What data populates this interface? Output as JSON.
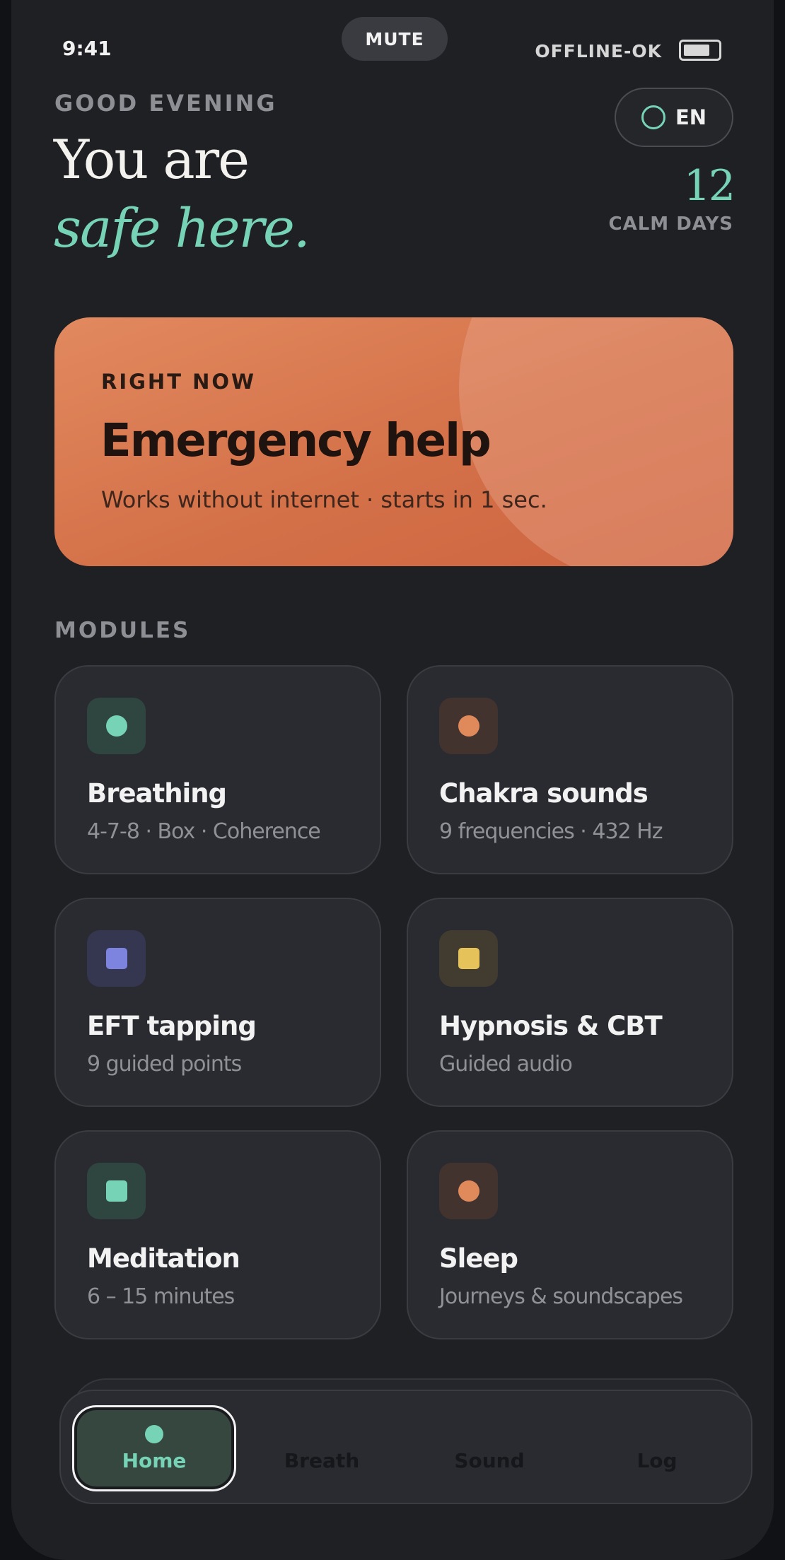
{
  "status": {
    "time": "9:41",
    "mute": "MUTE",
    "offline": "OFFLINE-OK"
  },
  "header": {
    "greeting": "GOOD EVENING",
    "title_line1": "You are",
    "title_line2": "safe here.",
    "language": "EN",
    "calm_days_value": "12",
    "calm_days_label": "CALM DAYS"
  },
  "emergency": {
    "kicker": "RIGHT NOW",
    "title": "Emergency help",
    "subtitle": "Works without internet · starts in 1 sec."
  },
  "modules": {
    "label": "MODULES",
    "items": [
      {
        "title": "Breathing",
        "subtitle": "4-7-8 · Box · Coherence",
        "icon": "breathing-dot-icon",
        "color": "#76d3b6"
      },
      {
        "title": "Chakra sounds",
        "subtitle": "9 frequencies · 432 Hz",
        "icon": "chakra-dot-icon",
        "color": "#e08a5c"
      },
      {
        "title": "EFT tapping",
        "subtitle": "9 guided points",
        "icon": "eft-square-icon",
        "color": "#7d84e0"
      },
      {
        "title": "Hypnosis & CBT",
        "subtitle": "Guided audio",
        "icon": "hypnosis-square-icon",
        "color": "#e6c35a"
      },
      {
        "title": "Meditation",
        "subtitle": "6 – 15 minutes",
        "icon": "meditation-square-icon",
        "color": "#76d3b6"
      },
      {
        "title": "Sleep",
        "subtitle": "Journeys & soundscapes",
        "icon": "sleep-dot-icon",
        "color": "#e08a5c"
      }
    ]
  },
  "nav": {
    "items": [
      {
        "label": "Home",
        "active": true
      },
      {
        "label": "Breath",
        "active": false
      },
      {
        "label": "Sound",
        "active": false
      },
      {
        "label": "Log",
        "active": false
      }
    ]
  }
}
